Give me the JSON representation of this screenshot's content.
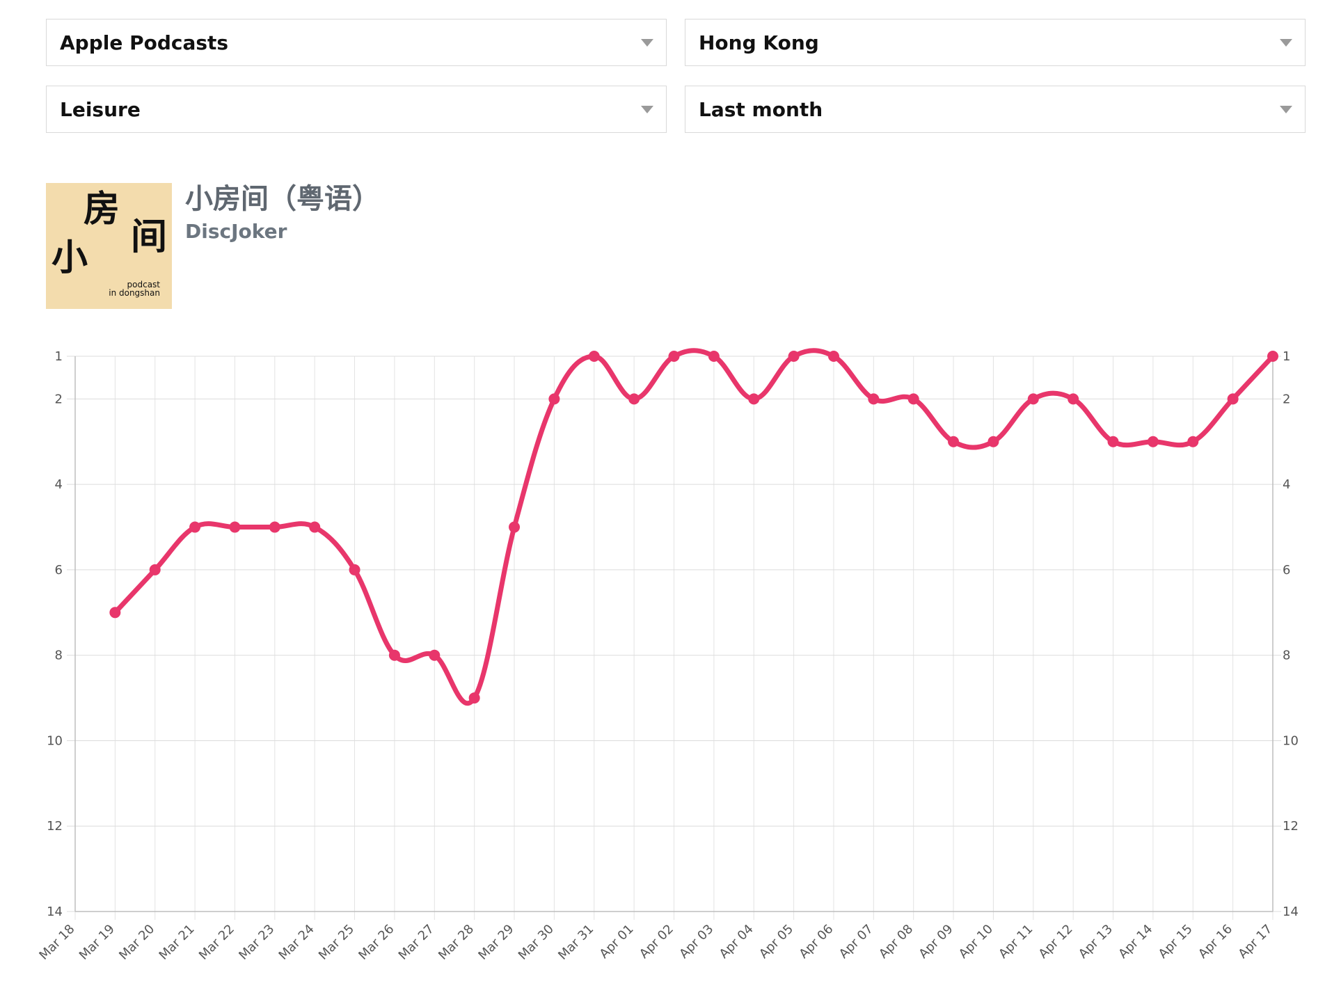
{
  "filters": {
    "platform": "Apple Podcasts",
    "region": "Hong Kong",
    "category": "Leisure",
    "period": "Last month"
  },
  "podcast": {
    "title": "小房间（粤语）",
    "author": "DiscJoker",
    "cover": {
      "char_1": "房",
      "char_2": "小",
      "char_3": "间",
      "tag_line_1": "podcast",
      "tag_line_2": "in dongshan",
      "background_color": "#f3dcad"
    }
  },
  "chart_data": {
    "type": "line",
    "categories": [
      "Mar 18",
      "Mar 19",
      "Mar 20",
      "Mar 21",
      "Mar 22",
      "Mar 23",
      "Mar 24",
      "Mar 25",
      "Mar 26",
      "Mar 27",
      "Mar 28",
      "Mar 29",
      "Mar 30",
      "Mar 31",
      "Apr 01",
      "Apr 02",
      "Apr 03",
      "Apr 04",
      "Apr 05",
      "Apr 06",
      "Apr 07",
      "Apr 08",
      "Apr 09",
      "Apr 10",
      "Apr 11",
      "Apr 12",
      "Apr 13",
      "Apr 14",
      "Apr 15",
      "Apr 16",
      "Apr 17"
    ],
    "series": [
      {
        "values": [
          null,
          7,
          6,
          5,
          5,
          5,
          5,
          6,
          8,
          8,
          9,
          5,
          2,
          1,
          2,
          1,
          1,
          2,
          1,
          1,
          2,
          2,
          3,
          3,
          2,
          2,
          3,
          3,
          3,
          2,
          1
        ],
        "color": "#e8366b"
      }
    ],
    "y_tick_labels": [
      "1",
      "2",
      "4",
      "6",
      "8",
      "10",
      "12",
      "14"
    ],
    "ylim": [
      1,
      14
    ],
    "y_reversed": true,
    "grid": true,
    "smooth": true,
    "y_axis_both_sides": true
  }
}
